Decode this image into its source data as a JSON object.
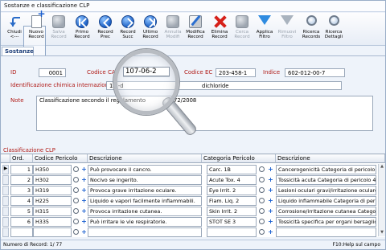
{
  "window": {
    "title": "Sostanze e classificazione CLP"
  },
  "toolbar": [
    {
      "label": "Chiudi\n<---",
      "icon": "back-arrow-icon",
      "enabled": true
    },
    {
      "label": "Nuovo\nRecord",
      "icon": "new-record-icon",
      "enabled": true
    },
    {
      "label": "Salva\nRecord",
      "icon": "save-icon",
      "enabled": false
    },
    {
      "label": "Primo\nRecord",
      "icon": "first-record-icon",
      "enabled": true
    },
    {
      "label": "Record\nPrec",
      "icon": "previous-record-icon",
      "enabled": true
    },
    {
      "label": "Record\nSucc",
      "icon": "next-record-icon",
      "enabled": true
    },
    {
      "label": "Ultimo\nRecord",
      "icon": "last-record-icon",
      "enabled": true
    },
    {
      "label": "Annulla\nModifi",
      "icon": "undo-icon",
      "enabled": false
    },
    {
      "label": "Modifica\nRecord",
      "icon": "edit-icon",
      "enabled": true
    },
    {
      "label": "Elimina\nRecord",
      "icon": "delete-icon",
      "enabled": true
    },
    {
      "label": "Cerca\nRecord",
      "icon": "search-record-icon",
      "enabled": false
    },
    {
      "label": "Applica\nFiltro",
      "icon": "filter-icon",
      "enabled": true
    },
    {
      "label": "Rimuovi\nFiltro",
      "icon": "remove-filter-icon",
      "enabled": false
    },
    {
      "label": "Ricerca\nRecords",
      "icon": "magnifier-icon",
      "enabled": true
    },
    {
      "label": "Ricerca\nDettagli",
      "icon": "magnifier-details-icon",
      "enabled": true
    }
  ],
  "section_tab": "Sostanze",
  "form": {
    "id_label": "ID",
    "id_value": "0001",
    "cas_label": "Codice CAS",
    "cas_value": "107-06-2",
    "ec_label": "Codice EC",
    "ec_value": "203-458-1",
    "index_label": "Indice",
    "index_value": "602-012-00-7",
    "chem_label": "Identificazione chimica internazionale",
    "chem_value_left": "1,2-d",
    "chem_value_right": "dichloride",
    "note_label": "Note",
    "note_value_left": "Classificazione secondo il regolamento",
    "note_value_right": "72/2008"
  },
  "grid": {
    "title": "Classificazione CLP",
    "headers": {
      "ord": "Ord.",
      "codice": "Codice Pericolo",
      "descr1": "Descrizione",
      "cat": "Categoria Pericolo",
      "descr2": "Descrizione"
    },
    "rows": [
      {
        "ord": "1",
        "code": "H350",
        "desc": "Può provocare il cancro.",
        "cat": "Carc. 1B",
        "catdesc": "Cancerogenicità Categoria di pericolo"
      },
      {
        "ord": "2",
        "code": "H302",
        "desc": "Nocivo se ingerito.",
        "cat": "Acute Tox. 4",
        "catdesc": "Tossicità acuta Categoria di pericolo 4"
      },
      {
        "ord": "3",
        "code": "H319",
        "desc": "Provoca grave irritazione oculare.",
        "cat": "Eye Irrit. 2",
        "catdesc": "Lesioni oculari gravi/irritazione oculare"
      },
      {
        "ord": "4",
        "code": "H225",
        "desc": "Liquido e vapori facilmente infiammabili.",
        "cat": "Flam. Liq. 2",
        "catdesc": "Liquido infiammabile Categoria di pericolo"
      },
      {
        "ord": "5",
        "code": "H315",
        "desc": "Provoca irritazione cutanea.",
        "cat": "Skin Irrit. 2",
        "catdesc": "Corrosione/irritazione cutanea Categoria d"
      },
      {
        "ord": "6",
        "code": "H335",
        "desc": "Può irritare le vie respiratorie.",
        "cat": "STOT SE 3",
        "catdesc": "Tossicità specifica per organi bersaglio"
      }
    ]
  },
  "status": {
    "left": "Numero di Record: 1/ 77",
    "right": "F10:Help sul campo"
  }
}
